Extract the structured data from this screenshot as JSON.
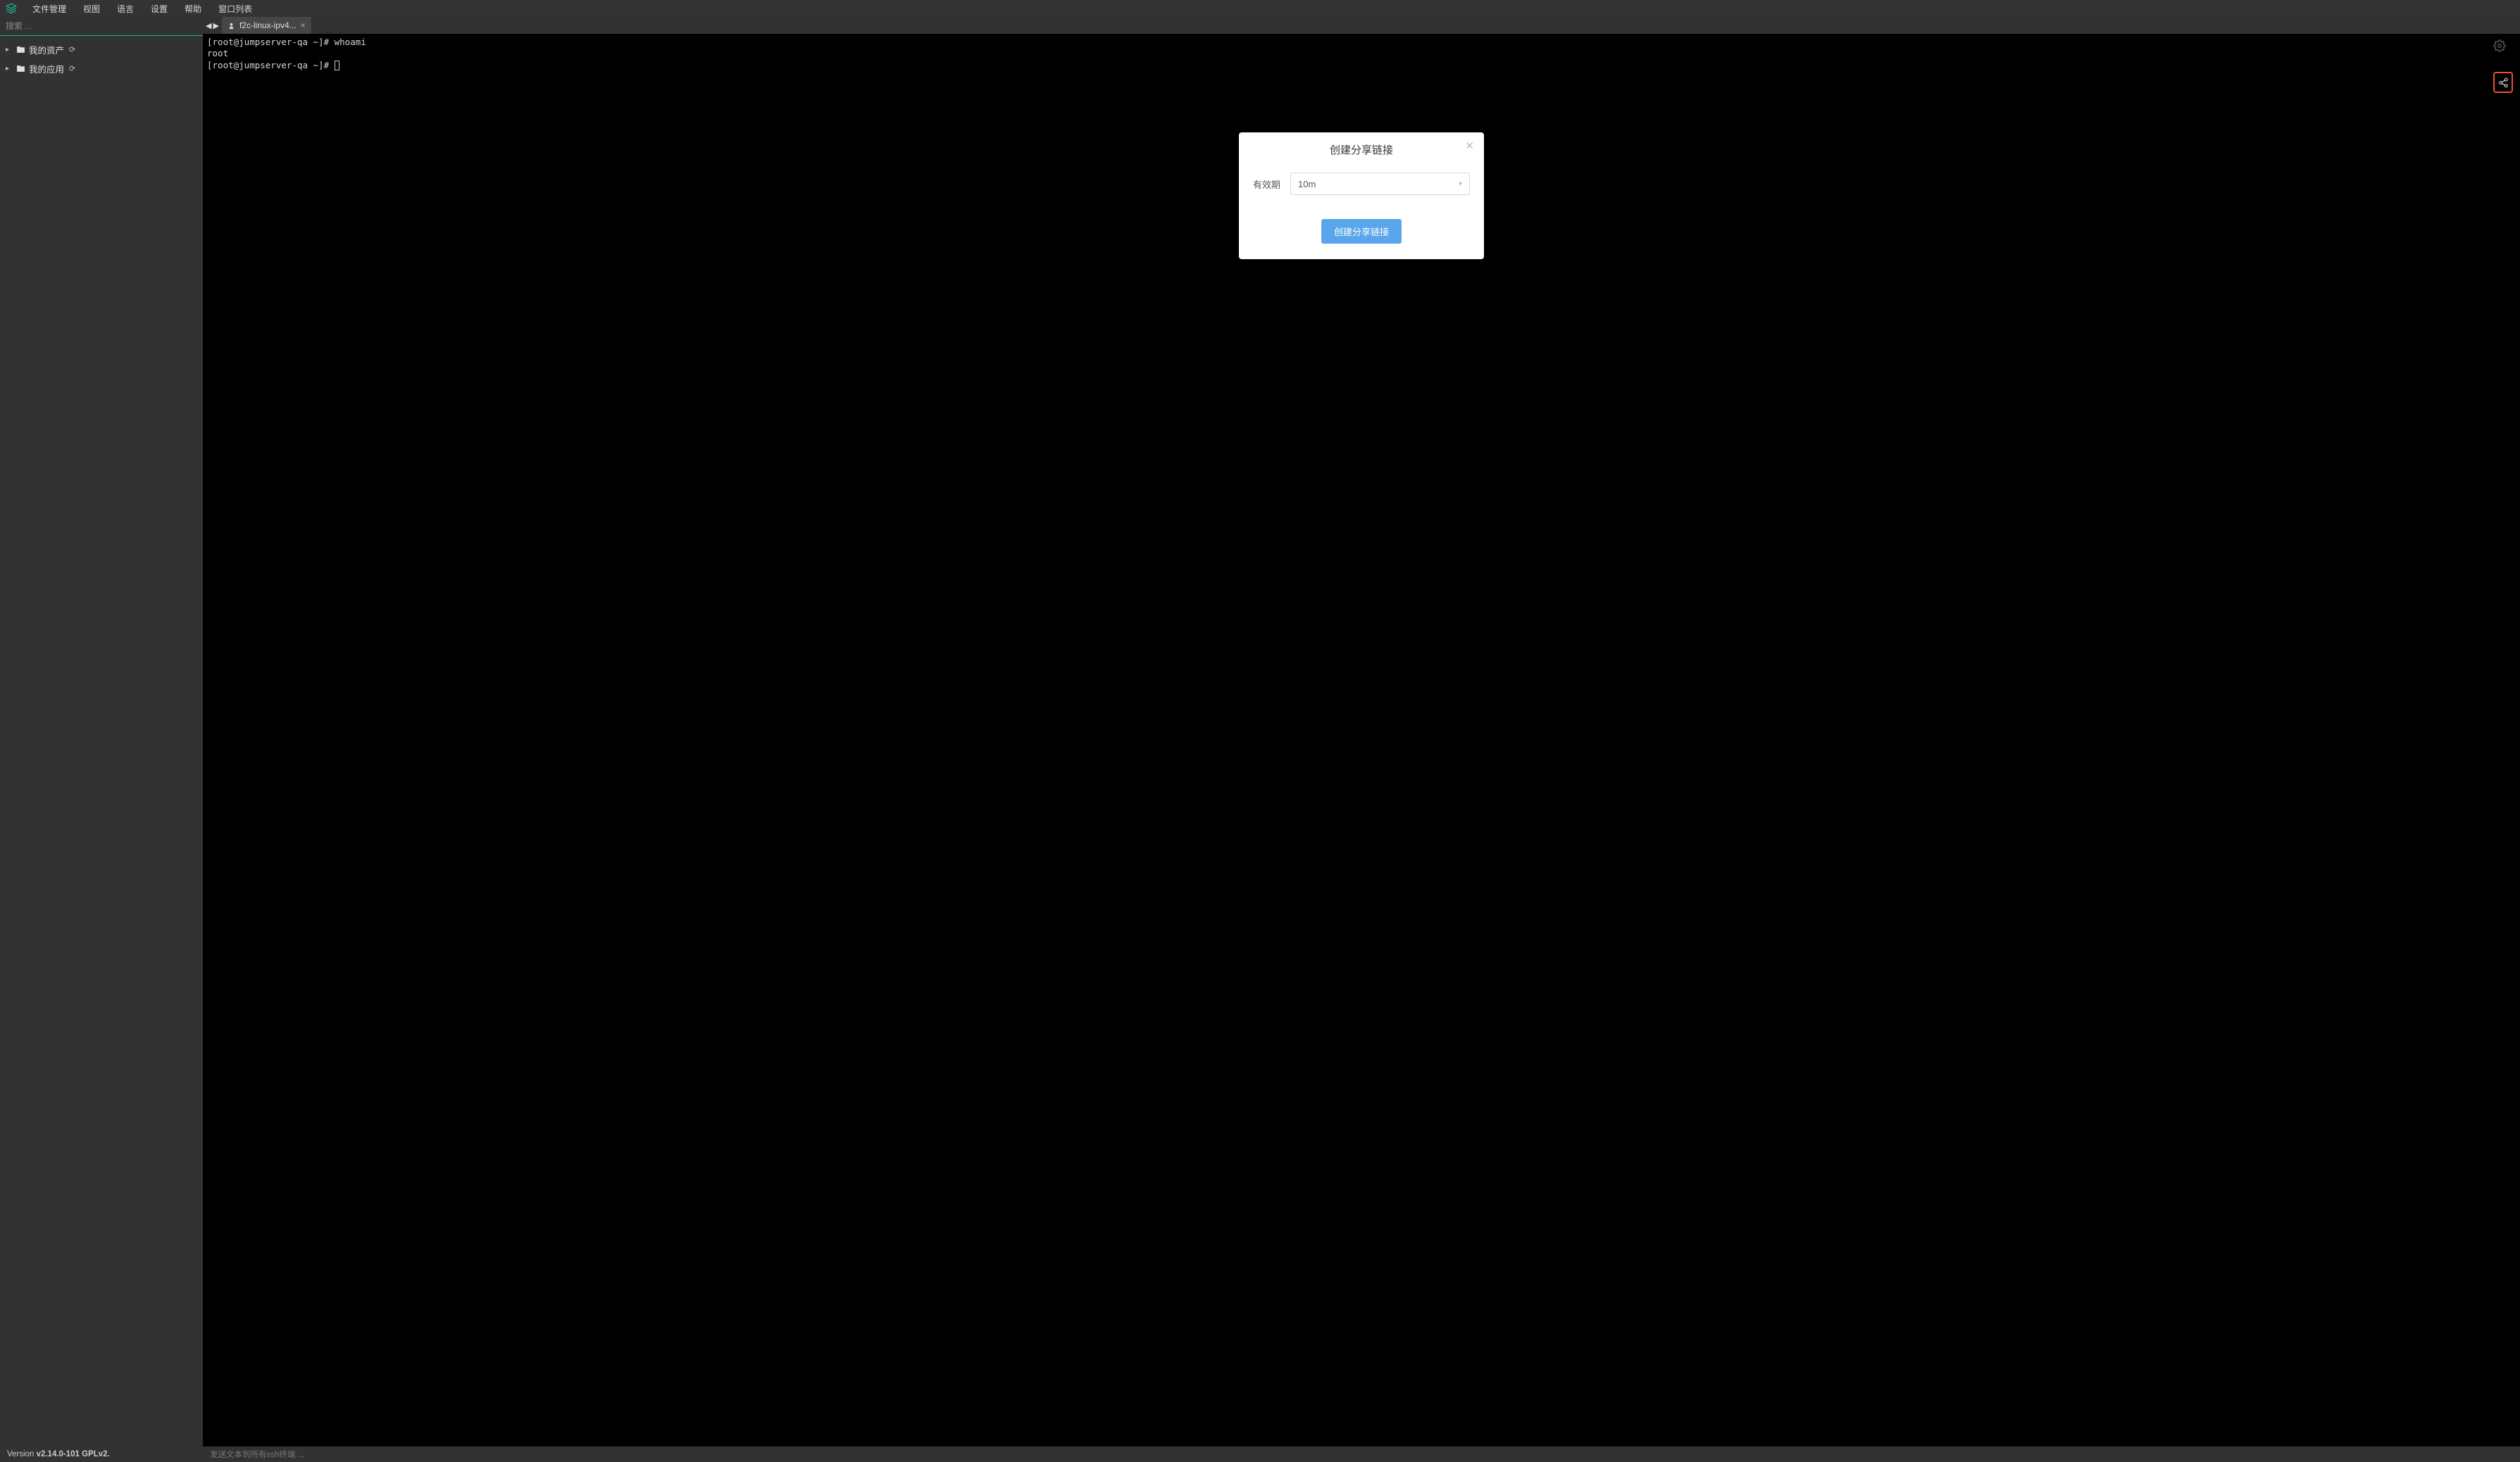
{
  "topmenu": {
    "items": [
      "文件管理",
      "视图",
      "语言",
      "设置",
      "帮助",
      "窗口列表"
    ]
  },
  "sidebar": {
    "search_placeholder": "搜索 ...",
    "tree": [
      {
        "label": "我的资产"
      },
      {
        "label": "我的应用"
      }
    ]
  },
  "tab": {
    "label": "f2c-linux-ipv4..."
  },
  "terminal": {
    "line1": "[root@jumpserver-qa ~]# whoami",
    "line2": "root",
    "line3": "[root@jumpserver-qa ~]# "
  },
  "modal": {
    "title": "创建分享链接",
    "expire_label": "有效期",
    "expire_value": "10m",
    "confirm": "创建分享链接"
  },
  "footer": {
    "version_prefix": "Version ",
    "version_bold": "v2.14.0-101 GPLv2.",
    "sendall": "发送文本到所有ssh终端 ..."
  }
}
